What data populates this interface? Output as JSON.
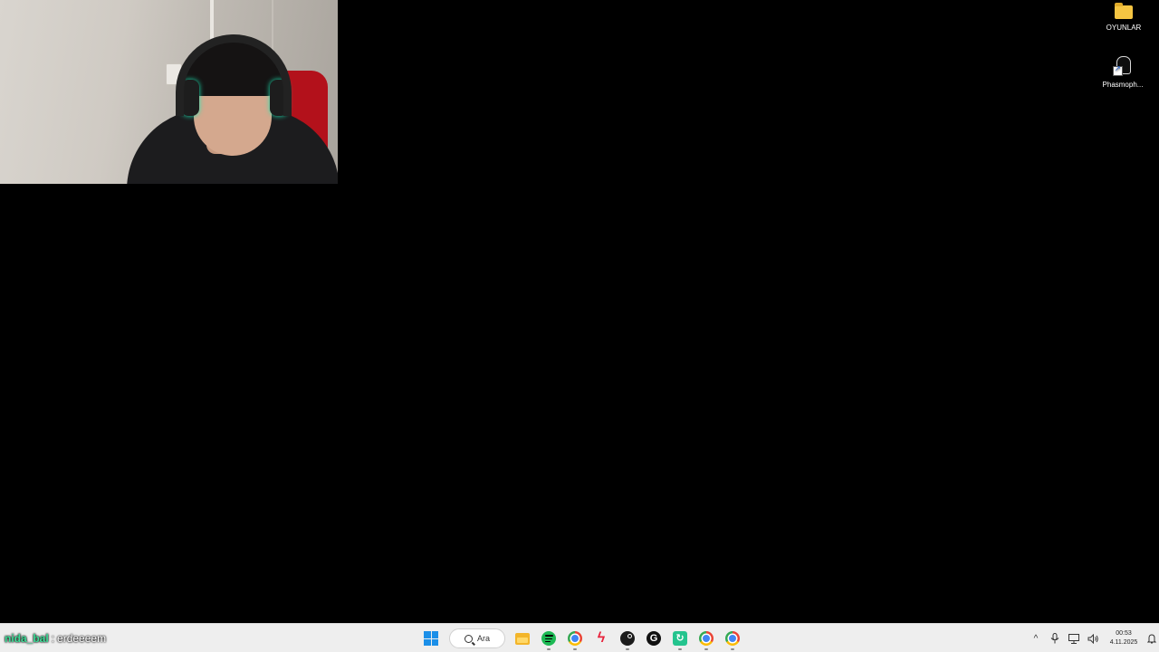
{
  "desktop": {
    "icons": [
      {
        "label": "OYUNLAR",
        "icon": "folder-icon"
      },
      {
        "label": "Phasmoph...",
        "icon": "phasmophobia-shortcut-icon"
      }
    ]
  },
  "chat": {
    "username": "nida_bal",
    "separator": ":",
    "message": "erdeeeem"
  },
  "taskbar": {
    "search_placeholder": "Ara",
    "apps": [
      "start-icon",
      "search-icon",
      "file-explorer-icon",
      "spotify-icon",
      "chrome-icon",
      "bolt-app-icon",
      "steam-icon",
      "g-app-icon",
      "green-app-icon",
      "chrome-profile-icon",
      "chrome-profile-2-icon"
    ],
    "tray": {
      "chevron": "^",
      "time": "00:53",
      "date": "4.11.2025"
    }
  },
  "colors": {
    "desktop_bg": "#000000",
    "taskbar_bg": "#eeeeee",
    "chat_username": "#3ddc97",
    "windows_blue": "#1b8fe8"
  }
}
